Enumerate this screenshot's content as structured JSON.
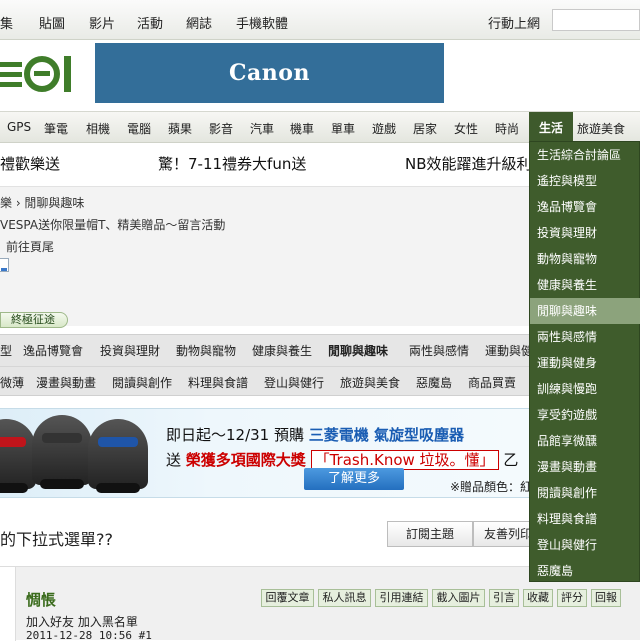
{
  "topbar": {
    "links": [
      "集",
      "貼圖",
      "影片",
      "活動",
      "網誌",
      "手機軟體"
    ],
    "mobile": "行動上網"
  },
  "banner": {
    "brand": "Canon"
  },
  "category_nav": {
    "items": [
      "GPS",
      "筆電",
      "相機",
      "電腦",
      "蘋果",
      "影音",
      "汽車",
      "機車",
      "單車",
      "遊戲",
      "居家",
      "女性",
      "時尚"
    ],
    "selected": "生活",
    "after": "旅遊美食"
  },
  "promo": [
    "禮歡樂送",
    "驚！7-11禮券大fun送",
    "NB效能躍進升級利"
  ],
  "breadcrumb": {
    "path": "樂 › 閒聊與趣味",
    "announcement": "VESPA送你限量帽T、精美贈品～留言活動",
    "prev": "前往頁尾",
    "tag": "終極征途"
  },
  "sub_nav": {
    "row1": [
      "型",
      "逸品博覽會",
      "投資與理財",
      "動物與寵物",
      "健康與養生",
      "閒聊與趣味",
      "兩性與感情",
      "運動與健"
    ],
    "row1_bold": "閒聊與趣味",
    "row2": [
      "微薄",
      "漫畫與動畫",
      "閱讀與創作",
      "料理與食譜",
      "登山與健行",
      "旅遊與美食",
      "惡魔島",
      "商品買賣"
    ]
  },
  "ad": {
    "line1_prefix": "即日起～12/31 預購",
    "line1_highlight": "三菱電機 氣旋型吸塵器",
    "line2_prefix": "送",
    "line2_red": "榮獲多項國際大獎",
    "line2_box": "「Trash.Know 垃圾。懂」",
    "line2_suffix": "乙",
    "more": "了解更多",
    "note": "※贈品顏色：紅"
  },
  "thread": {
    "title": "的下拉式選單??",
    "subscribe": "訂閱主題",
    "print": "友善列印"
  },
  "post": {
    "author": "惆悵",
    "friend_links": "加入好友 加入黑名單",
    "datetime": "2011-12-28 10:56",
    "floor": "#1",
    "actions": [
      "回覆文章",
      "私人訊息",
      "引用連結",
      "截入圖片",
      "引言",
      "收藏",
      "評分",
      "回報"
    ]
  },
  "dropdown": {
    "items": [
      "生活綜合討論區",
      "遙控與模型",
      "逸品博覽會",
      "投資與理財",
      "動物與寵物",
      "健康與養生",
      "閒聊與趣味",
      "兩性與感情",
      "運動與健身",
      "訓練與慢跑",
      "享受釣遊戲",
      "品館享微醺",
      "漫畫與動畫",
      "閱讀與創作",
      "料理與食譜",
      "登山與健行",
      "惡魔島"
    ],
    "highlighted": "閒聊與趣味",
    "highlighted_index": 6
  },
  "colors": {
    "nav_green": "#3e5a2c",
    "highlight": "#8ca37c",
    "banner_blue": "#336e99"
  }
}
